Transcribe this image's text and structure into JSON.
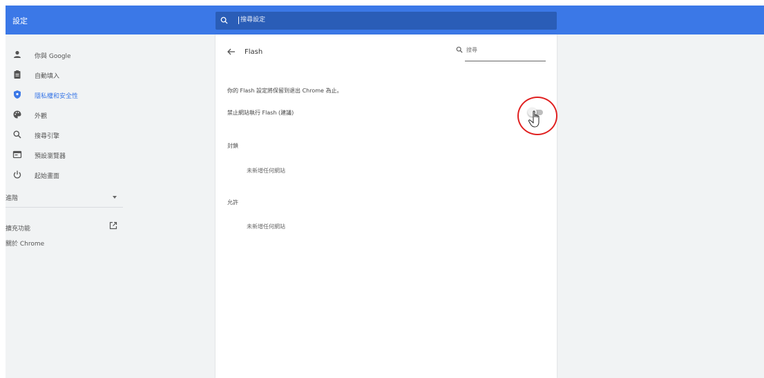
{
  "header": {
    "title": "設定",
    "search_placeholder": "搜尋設定"
  },
  "sidebar": {
    "items": [
      {
        "label": "你與 Google",
        "icon": "person-icon"
      },
      {
        "label": "自動填入",
        "icon": "clipboard-icon"
      },
      {
        "label": "隱私權和安全性",
        "icon": "shield-icon",
        "active": true
      },
      {
        "label": "外觀",
        "icon": "palette-icon"
      },
      {
        "label": "搜尋引擎",
        "icon": "search-icon"
      },
      {
        "label": "預設瀏覽器",
        "icon": "browser-icon"
      },
      {
        "label": "起始畫面",
        "icon": "power-icon"
      }
    ],
    "advanced_label": "進階",
    "extensions_label": "擴充功能",
    "about_label": "關於 Chrome"
  },
  "page": {
    "title": "Flash",
    "search_placeholder": "搜尋",
    "notice": "你的 Flash 設定將保留到退出 Chrome 為止。",
    "block_toggle_label": "禁止網站執行 Flash (建議)",
    "block_toggle_on": false,
    "sections": [
      {
        "title": "封鎖",
        "empty_text": "未新增任何網站"
      },
      {
        "title": "允許",
        "empty_text": "未新增任何網站"
      }
    ]
  },
  "colors": {
    "accent": "#3b78e7",
    "highlight_circle": "#e02020"
  }
}
